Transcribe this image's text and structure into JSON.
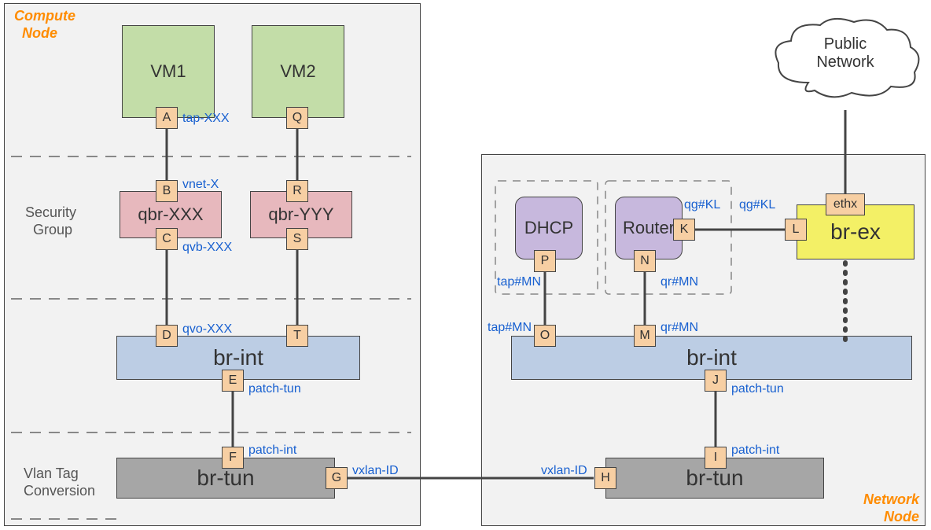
{
  "compute": {
    "title_l1": "Compute",
    "title_l2": "Node",
    "sec_group_l1": "Security",
    "sec_group_l2": "Group",
    "vlan_l1": "Vlan Tag",
    "vlan_l2": "Conversion",
    "vm1": "VM1",
    "vm2": "VM2",
    "qbrX": "qbr-XXX",
    "qbrY": "qbr-YYY",
    "brint": "br-int",
    "brtun": "br-tun"
  },
  "network": {
    "title_l1": "Network",
    "title_l2": "Node",
    "dhcp": "DHCP",
    "router": "Router",
    "brint": "br-int",
    "brtun": "br-tun",
    "brex": "br-ex"
  },
  "ports": {
    "A": "A",
    "B": "B",
    "C": "C",
    "D": "D",
    "E": "E",
    "F": "F",
    "G": "G",
    "H": "H",
    "I": "I",
    "J": "J",
    "K": "K",
    "L": "L",
    "M": "M",
    "N": "N",
    "O": "O",
    "P": "P",
    "Q": "Q",
    "R": "R",
    "S": "S",
    "T": "T",
    "ethx": "ethx"
  },
  "labels": {
    "tapXXX": "tap-XXX",
    "vnetX": "vnet-X",
    "qvbXXX": "qvb-XXX",
    "qvoXXX": "qvo-XXX",
    "patchtun1": "patch-tun",
    "patchint1": "patch-int",
    "vxlanID1": "vxlan-ID",
    "vxlanID2": "vxlan-ID",
    "patchint2": "patch-int",
    "patchtun2": "patch-tun",
    "tapMN1": "tap#MN",
    "tapMN2": "tap#MN",
    "qrMN1": "qr#MN",
    "qrMN2": "qr#MN",
    "qgKL1": "qg#KL",
    "qgKL2": "qg#KL"
  },
  "cloud": {
    "l1": "Public",
    "l2": "Network"
  }
}
